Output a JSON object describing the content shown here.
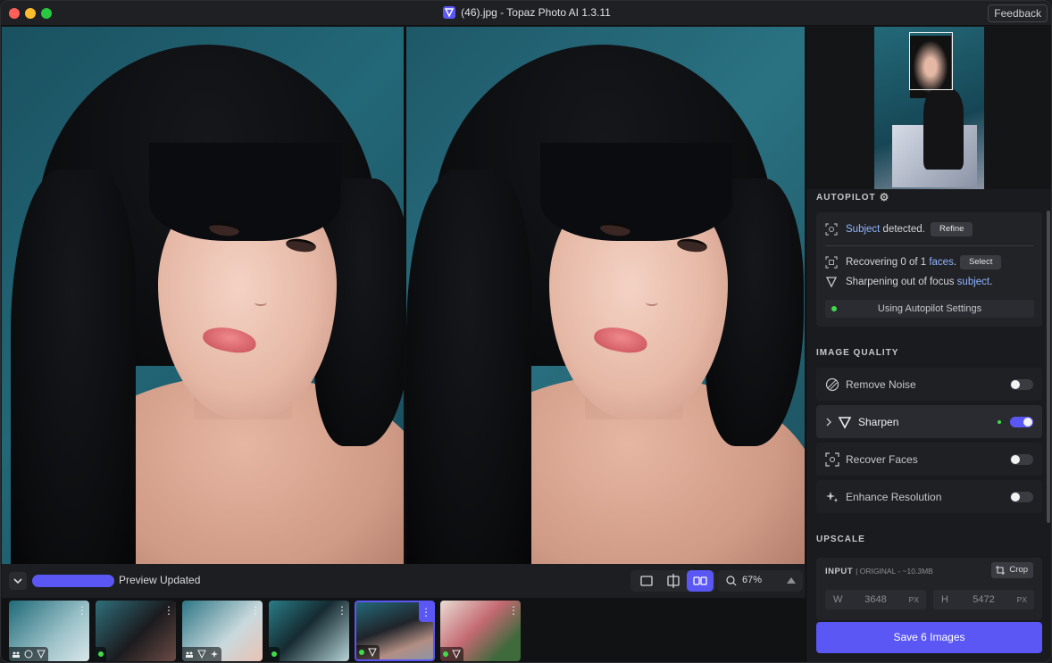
{
  "window": {
    "title": "(46).jpg - Topaz Photo AI 1.3.11",
    "feedback_label": "Feedback"
  },
  "toolbar": {
    "preview_status": "Preview Updated",
    "zoom_level": "67%"
  },
  "panel": {
    "autopilot_label": "AUTOPILOT",
    "subject_link": "Subject",
    "subject_text": " detected.",
    "refine_label": "Refine",
    "recovering_text": "Recovering 0 of 1 ",
    "faces_link": "faces",
    "select_label": "Select",
    "sharpening_text": "Sharpening out of focus ",
    "sharpening_link": "subject",
    "autopilot_settings_label": "Using Autopilot Settings",
    "image_quality_label": "IMAGE QUALITY",
    "features": [
      {
        "label": "Remove Noise",
        "enabled": false
      },
      {
        "label": "Sharpen",
        "enabled": true
      },
      {
        "label": "Recover Faces",
        "enabled": false
      },
      {
        "label": "Enhance Resolution",
        "enabled": false
      }
    ],
    "upscale_label": "UPSCALE",
    "input_label": "INPUT",
    "input_sub": "| ORIGINAL - ~10.3MB",
    "crop_label": "Crop",
    "width_letter": "W",
    "width_value": "3648",
    "height_letter": "H",
    "height_value": "5472",
    "unit": "PX",
    "save_label": "Save 6 Images"
  },
  "colors": {
    "accent": "#5b57f5",
    "status_green": "#3fdc4a",
    "link": "#8fb4ff"
  }
}
